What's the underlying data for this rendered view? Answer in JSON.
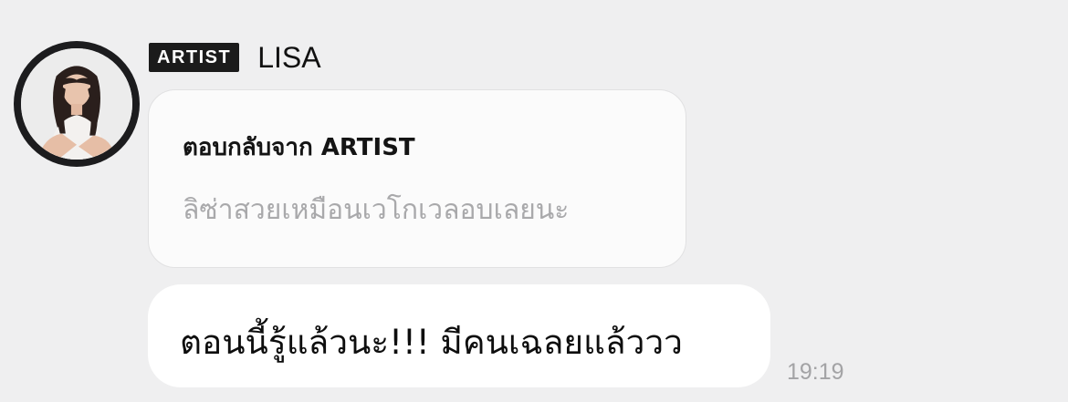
{
  "sender": {
    "badge": "ARTIST",
    "name": "LISA",
    "avatar_icon": "profile-photo-avatar"
  },
  "reply": {
    "title": "ตอบกลับจาก ARTIST",
    "quoted_text": "ลิซ่าสวยเหมือนเวโกเวลอบเลยนะ"
  },
  "message": {
    "text": "ตอนนี้รู้แล้วนะ!!! มีคนเฉลยแล้ววว",
    "time": "19:19"
  },
  "colors": {
    "background": "#efeff0",
    "badge_bg": "#1b1b1b",
    "bubble_bg": "#ffffff",
    "quote_text": "#a9a9ab",
    "timestamp": "#a3a3a5"
  }
}
